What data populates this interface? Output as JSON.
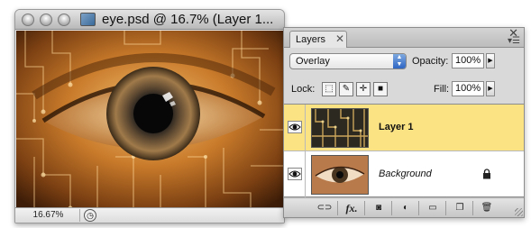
{
  "document_window": {
    "title": "eye.psd @ 16.7% (Layer 1...",
    "zoom": "16.67%",
    "buttons": [
      "close-icon",
      "minimize-icon",
      "zoom-icon"
    ],
    "status_icon": "info-clock-icon"
  },
  "layers_panel": {
    "tab_label": "Layers",
    "tab_close": "✕",
    "panel_close": "✕",
    "panel_menu": "▾☰",
    "blend_mode": "Overlay",
    "opacity_label": "Opacity:",
    "opacity_value": "100%",
    "lock_label": "Lock:",
    "lock_options": [
      "lock-transparent-icon",
      "lock-pixels-icon",
      "lock-position-icon",
      "lock-all-icon"
    ],
    "fill_label": "Fill:",
    "fill_value": "100%",
    "layers": [
      {
        "name": "Layer 1",
        "selected": true,
        "visible": true,
        "locked": false
      },
      {
        "name": "Background",
        "selected": false,
        "visible": true,
        "locked": true
      }
    ],
    "footer_buttons": [
      "link-layers-icon",
      "fx-icon",
      "add-mask-icon",
      "adjustment-layer-icon",
      "new-group-icon",
      "new-layer-icon",
      "trash-icon"
    ],
    "footer_fx_label": "fx."
  },
  "colors": {
    "selected_row": "#fbe283",
    "accent_blue": "#2f66c3"
  }
}
